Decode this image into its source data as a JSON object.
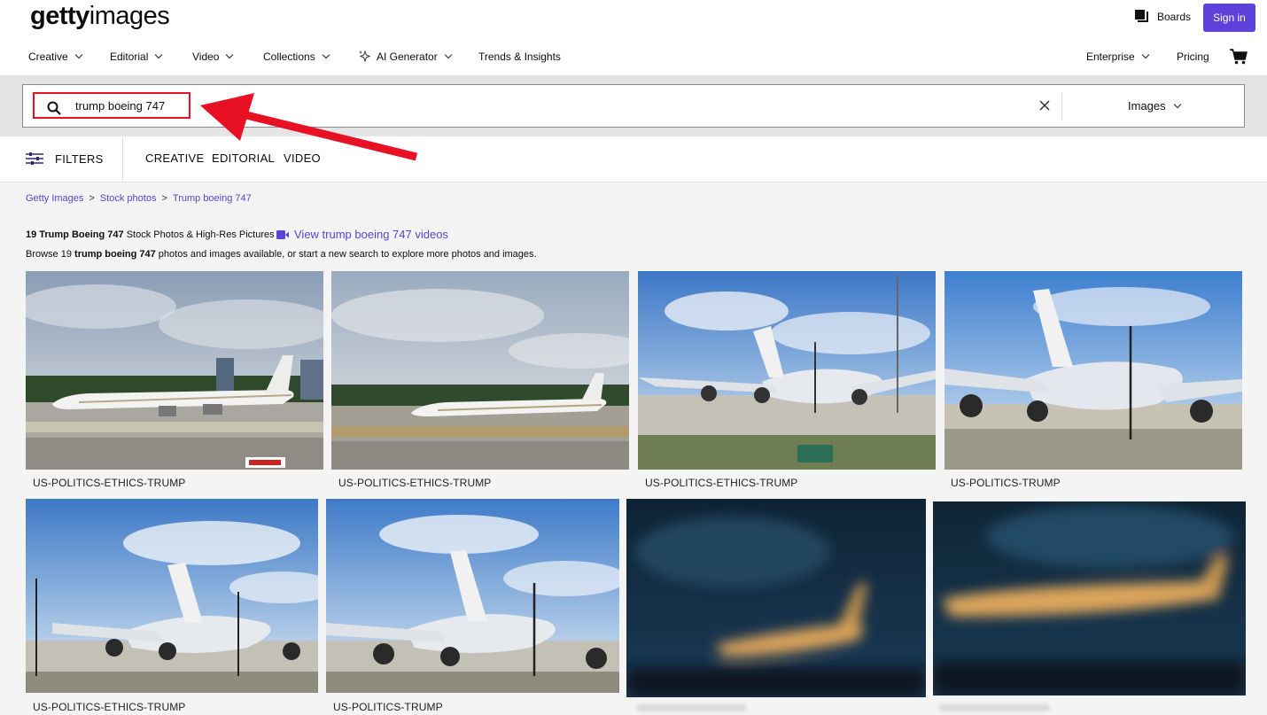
{
  "header": {
    "logo_bold": "getty",
    "logo_light": "images",
    "boards_label": "Boards",
    "signin_label": "Sign in",
    "nav_left": [
      {
        "label": "Creative"
      },
      {
        "label": "Editorial"
      },
      {
        "label": "Video"
      },
      {
        "label": "Collections"
      },
      {
        "label": "AI Generator"
      },
      {
        "label": "Trends & Insights"
      }
    ],
    "nav_right": [
      {
        "label": "Enterprise"
      },
      {
        "label": "Pricing"
      }
    ]
  },
  "search": {
    "query": "trump boeing 747",
    "media_type": "Images"
  },
  "filters": {
    "label": "FILTERS",
    "tabs": [
      "CREATIVE",
      "EDITORIAL",
      "VIDEO"
    ]
  },
  "breadcrumb": [
    "Getty Images",
    "Stock photos",
    "Trump boeing 747"
  ],
  "results": {
    "count_bold": "19 Trump Boeing 747",
    "count_rest": "Stock Photos & High-Res Pictures",
    "video_link": "View trump boeing 747 videos",
    "browse_pre": "Browse 19",
    "browse_bold": "trump boeing 747",
    "browse_post": "photos and images available, or start a new search to explore more photos and images."
  },
  "images": [
    {
      "caption": "US-POLITICS-ETHICS-TRUMP"
    },
    {
      "caption": "US-POLITICS-ETHICS-TRUMP"
    },
    {
      "caption": "US-POLITICS-ETHICS-TRUMP"
    },
    {
      "caption": "US-POLITICS-TRUMP"
    },
    {
      "caption": "US-POLITICS-ETHICS-TRUMP"
    },
    {
      "caption": "US-POLITICS-TRUMP"
    }
  ],
  "colors": {
    "accent": "#5d41d9",
    "highlight": "#e81123"
  }
}
